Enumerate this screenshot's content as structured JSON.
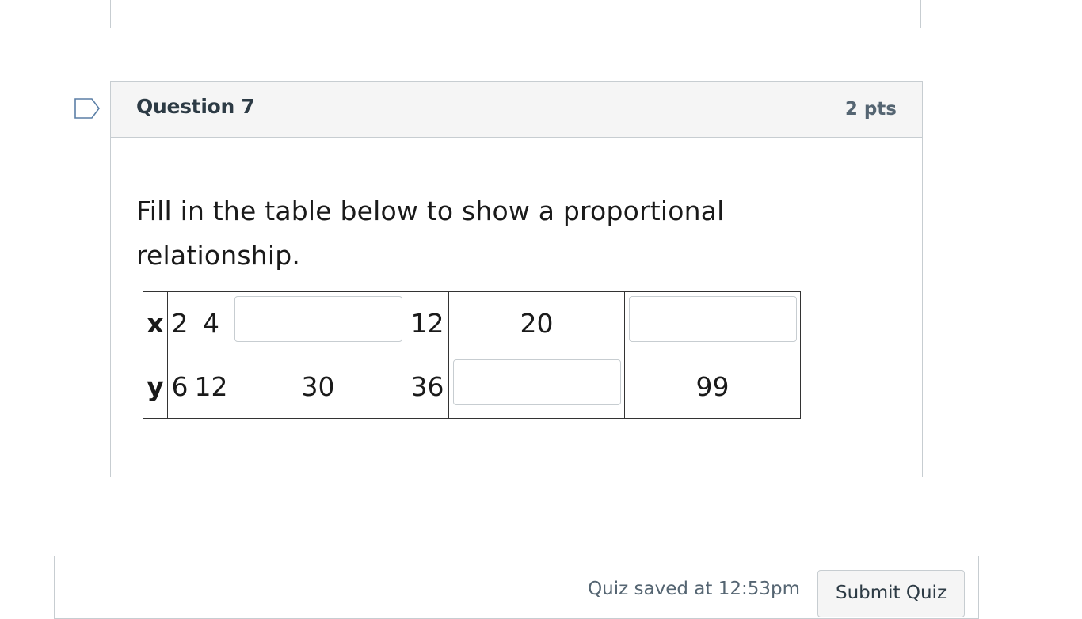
{
  "question": {
    "title": "Question 7",
    "points": "2 pts",
    "text": "Fill in the table below to show a proportional relationship.",
    "flag_icon": "flag-outline-icon",
    "table": {
      "row_x": {
        "label": "x",
        "cells": [
          "2",
          "4",
          "",
          "12",
          "20",
          ""
        ]
      },
      "row_y": {
        "label": "y",
        "cells": [
          "6",
          "12",
          "30",
          "36",
          "",
          "99"
        ]
      },
      "blank_inputs": [
        {
          "row": "x",
          "col": 3,
          "value": ""
        },
        {
          "row": "x",
          "col": 6,
          "value": ""
        },
        {
          "row": "y",
          "col": 5,
          "value": ""
        }
      ]
    }
  },
  "footer": {
    "saved_text": "Quiz saved at 12:53pm",
    "submit_label": "Submit Quiz"
  },
  "colors": {
    "border": "#c7cdd1",
    "header_bg": "#f5f5f5",
    "flag": "#5b7fa6"
  }
}
